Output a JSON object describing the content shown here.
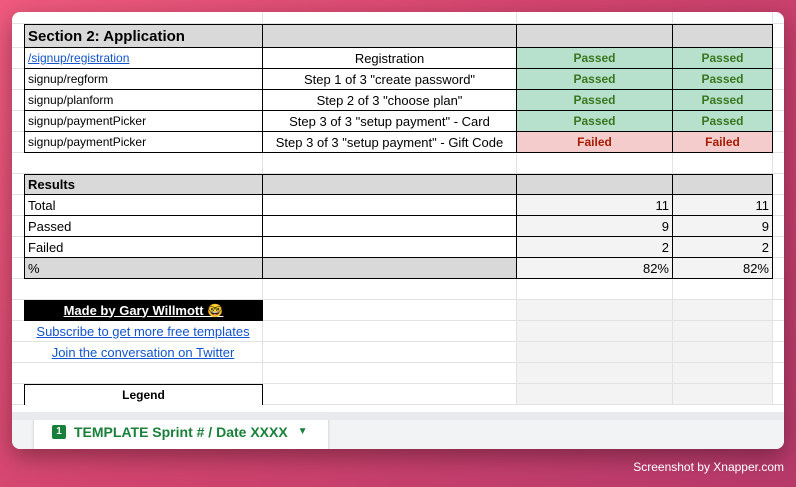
{
  "section": {
    "title": "Section 2: Application"
  },
  "app_rows": [
    {
      "path": "/signup/registration",
      "is_link": true,
      "step": "Registration",
      "r1": "Passed",
      "r2": "Passed"
    },
    {
      "path": "signup/regform",
      "step": "Step 1 of 3 \"create password\"",
      "r1": "Passed",
      "r2": "Passed"
    },
    {
      "path": "signup/planform",
      "step": "Step 2 of 3 \"choose plan\"",
      "r1": "Passed",
      "r2": "Passed"
    },
    {
      "path": "signup/paymentPicker",
      "step": "Step 3 of 3 \"setup payment\" - Card",
      "r1": "Passed",
      "r2": "Passed"
    },
    {
      "path": "signup/paymentPicker",
      "step": "Step 3 of 3 \"setup payment\" - Gift Code",
      "r1": "Failed",
      "r2": "Failed"
    }
  ],
  "results": {
    "title": "Results",
    "rows": [
      {
        "label": "Total",
        "v1": "11",
        "v2": "11"
      },
      {
        "label": "Passed",
        "v1": "9",
        "v2": "9"
      },
      {
        "label": "Failed",
        "v1": "2",
        "v2": "2"
      },
      {
        "label": "%",
        "v1": "82%",
        "v2": "82%"
      }
    ]
  },
  "footer": {
    "made_by": "Made by Gary Willmott 🤓",
    "subscribe": "Subscribe to get more free templates",
    "twitter": "Join the conversation on Twitter",
    "legend": "Legend"
  },
  "tab": {
    "badge": "1",
    "label": "TEMPLATE Sprint # / Date XXXX",
    "caret": "▼"
  },
  "credit": "Screenshot by Xnapper.com",
  "colors": {
    "pass_bg": "#b7e1cd",
    "pass_text": "#38761d",
    "fail_bg": "#f4cccc",
    "fail_text": "#a61c00",
    "tab_green": "#188038"
  }
}
